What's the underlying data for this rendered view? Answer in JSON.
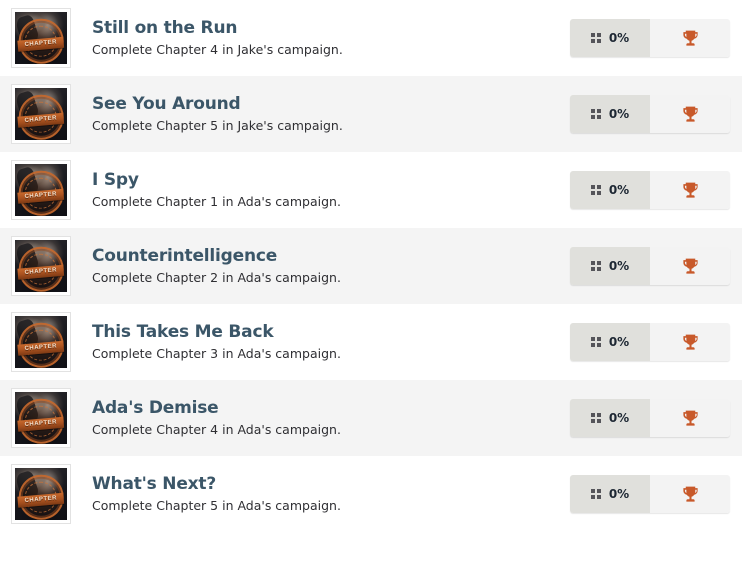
{
  "list": {
    "name": "achievement-list",
    "rows": [
      {
        "title": "Still on the Run",
        "description": "Complete Chapter 4 in Jake's campaign.",
        "progress": "0%",
        "thumbnail_label": "CHAPTER",
        "thumbnail_icon": "chapter-seal-thumbnail",
        "progress_icon": "grid-dots-icon",
        "award_icon": "trophy-icon"
      },
      {
        "title": "See You Around",
        "description": "Complete Chapter 5 in Jake's campaign.",
        "progress": "0%",
        "thumbnail_label": "CHAPTER",
        "thumbnail_icon": "chapter-seal-thumbnail",
        "progress_icon": "grid-dots-icon",
        "award_icon": "trophy-icon"
      },
      {
        "title": "I Spy",
        "description": "Complete Chapter 1 in Ada's campaign.",
        "progress": "0%",
        "thumbnail_label": "CHAPTER",
        "thumbnail_icon": "chapter-seal-thumbnail",
        "progress_icon": "grid-dots-icon",
        "award_icon": "trophy-icon"
      },
      {
        "title": "Counterintelligence",
        "description": "Complete Chapter 2 in Ada's campaign.",
        "progress": "0%",
        "thumbnail_label": "CHAPTER",
        "thumbnail_icon": "chapter-seal-thumbnail",
        "progress_icon": "grid-dots-icon",
        "award_icon": "trophy-icon"
      },
      {
        "title": "This Takes Me Back",
        "description": "Complete Chapter 3 in Ada's campaign.",
        "progress": "0%",
        "thumbnail_label": "CHAPTER",
        "thumbnail_icon": "chapter-seal-thumbnail",
        "progress_icon": "grid-dots-icon",
        "award_icon": "trophy-icon"
      },
      {
        "title": "Ada's Demise",
        "description": "Complete Chapter 4 in Ada's campaign.",
        "progress": "0%",
        "thumbnail_label": "CHAPTER",
        "thumbnail_icon": "chapter-seal-thumbnail",
        "progress_icon": "grid-dots-icon",
        "award_icon": "trophy-icon"
      },
      {
        "title": "What's Next?",
        "description": "Complete Chapter 5 in Ada's campaign.",
        "progress": "0%",
        "thumbnail_label": "CHAPTER",
        "thumbnail_icon": "chapter-seal-thumbnail",
        "progress_icon": "grid-dots-icon",
        "award_icon": "trophy-icon"
      }
    ]
  },
  "colors": {
    "row_background": "#ffffff",
    "row_background_alt": "#f4f4f4",
    "title_text": "#3b5668",
    "description_text": "#2f2f33",
    "progress_segment": "#e0e0dc",
    "award_segment": "#f3f3f3",
    "trophy_accent": "#c8592a",
    "progress_text": "#1d2733"
  }
}
